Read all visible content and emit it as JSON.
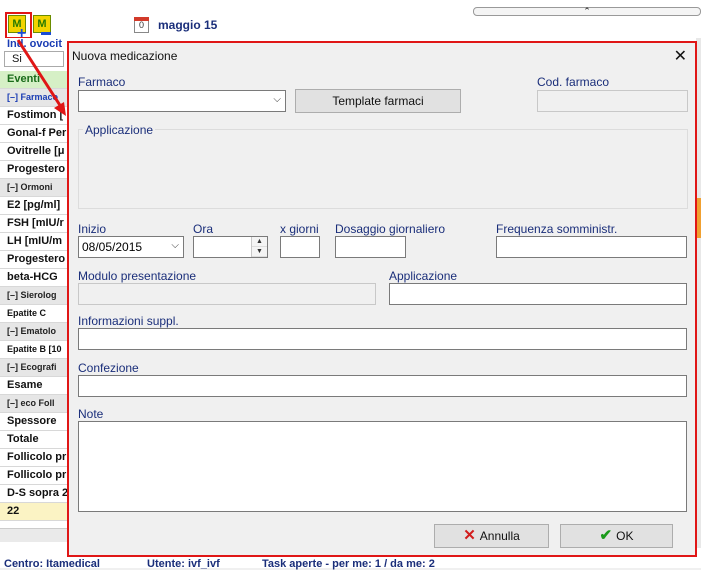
{
  "toolbar": {
    "add_icon_letter": "M",
    "remove_icon_letter": "M",
    "calendar_day": "0",
    "month_label": "maggio 15",
    "collapse_arrow": "⌃"
  },
  "left_panel": {
    "header_label": "Ind. ovocit",
    "filter_value": "Si",
    "rows": [
      {
        "label": "Eventi",
        "kind": "hdr"
      },
      {
        "label": "[–]  Farmaco",
        "kind": "group link"
      },
      {
        "label": "Fostimon [",
        "kind": ""
      },
      {
        "label": "Gonal-f Per",
        "kind": ""
      },
      {
        "label": "Ovitrelle [μ",
        "kind": ""
      },
      {
        "label": "Progestero",
        "kind": ""
      },
      {
        "label": "[–]  Ormoni",
        "kind": "group"
      },
      {
        "label": "E2  [pg/ml]",
        "kind": ""
      },
      {
        "label": "FSH  [mIU/r",
        "kind": ""
      },
      {
        "label": "LH  [mIU/m",
        "kind": ""
      },
      {
        "label": "Progestero",
        "kind": ""
      },
      {
        "label": "beta-HCG",
        "kind": ""
      },
      {
        "label": "[–]  Sierolog",
        "kind": "group"
      },
      {
        "label": "Epatite C",
        "kind": "small"
      },
      {
        "label": "[–]  Ematolo",
        "kind": "group"
      },
      {
        "label": "Epatite B  [10",
        "kind": "small"
      },
      {
        "label": "[–]  Ecografi",
        "kind": "group"
      },
      {
        "label": "Esame",
        "kind": ""
      },
      {
        "label": "[–]  eco Foll",
        "kind": "group"
      },
      {
        "label": "Spessore",
        "kind": ""
      },
      {
        "label": "Totale",
        "kind": ""
      },
      {
        "label": "Follicolo pr",
        "kind": ""
      },
      {
        "label": "Follicolo pr",
        "kind": ""
      },
      {
        "label": "D-S sopra 2",
        "kind": ""
      },
      {
        "label": "22",
        "kind": "yellow"
      }
    ]
  },
  "statusbar": {
    "centro": "Centro: Itamedical",
    "utente": "Utente: ivf_ivf",
    "task": "Task aperte - per me: 1 / da me: 2"
  },
  "dialog": {
    "title": "Nuova medicazione",
    "close_glyph": "✕",
    "farmaco_label": "Farmaco",
    "farmaco_value": "",
    "template_button": "Template farmaci",
    "cod_farmaco_label": "Cod. farmaco",
    "cod_farmaco_value": "",
    "applicazione_group_label": "Applicazione",
    "inizio_label": "Inizio",
    "inizio_value": "08/05/2015",
    "ora_label": "Ora",
    "ora_value": "",
    "x_giorni_label": "x giorni",
    "x_giorni_value": "",
    "dosaggio_label": "Dosaggio giornaliero",
    "dosaggio_value": "",
    "frequenza_label": "Frequenza somministr.",
    "frequenza_value": "",
    "modulo_label": "Modulo presentazione",
    "modulo_value": "",
    "applicazione_label": "Applicazione",
    "applicazione_value": "",
    "info_label": "Informazioni suppl.",
    "info_value": "",
    "confezione_label": "Confezione",
    "confezione_value": "",
    "note_label": "Note",
    "note_value": "",
    "annulla_button": "Annulla",
    "ok_button": "OK"
  },
  "colors": {
    "highlight_red": "#e01616",
    "label_blue": "#1a2e7a"
  }
}
